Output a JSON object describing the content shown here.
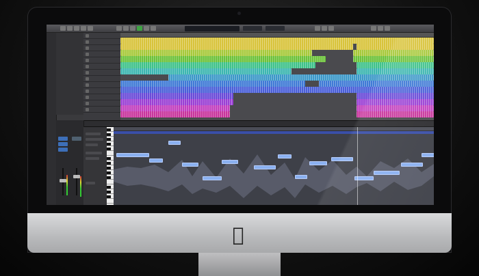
{
  "device": {
    "brand_icon": "apple-logo-icon",
    "brand_glyph": ""
  },
  "transport": {
    "lcd_readout": "",
    "buttons": [
      "rewind-icon",
      "forward-icon",
      "stop-icon",
      "play-icon",
      "record-icon",
      "cycle-icon"
    ]
  },
  "tracks": [
    {
      "color": "#d8c33a"
    },
    {
      "color": "#d8c33a"
    },
    {
      "color": "#a7c93a"
    },
    {
      "color": "#6cc23a"
    },
    {
      "color": "#3fc28a"
    },
    {
      "color": "#3cb6b0"
    },
    {
      "color": "#3c98c8"
    },
    {
      "color": "#3f7ad6"
    },
    {
      "color": "#4a5fd8"
    },
    {
      "color": "#6a4ad8"
    },
    {
      "color": "#9a3fd4"
    },
    {
      "color": "#c23fbe"
    },
    {
      "color": "#c8349c"
    }
  ],
  "editor": {
    "tabs": [
      "",
      "",
      "",
      ""
    ],
    "accent": "#3d6fb8",
    "note_color": "#8ab0f0"
  },
  "colors": {
    "screen_bg": "#3a3a3d",
    "chin": "#c9cacc",
    "bezel": "#0b0b0c"
  }
}
